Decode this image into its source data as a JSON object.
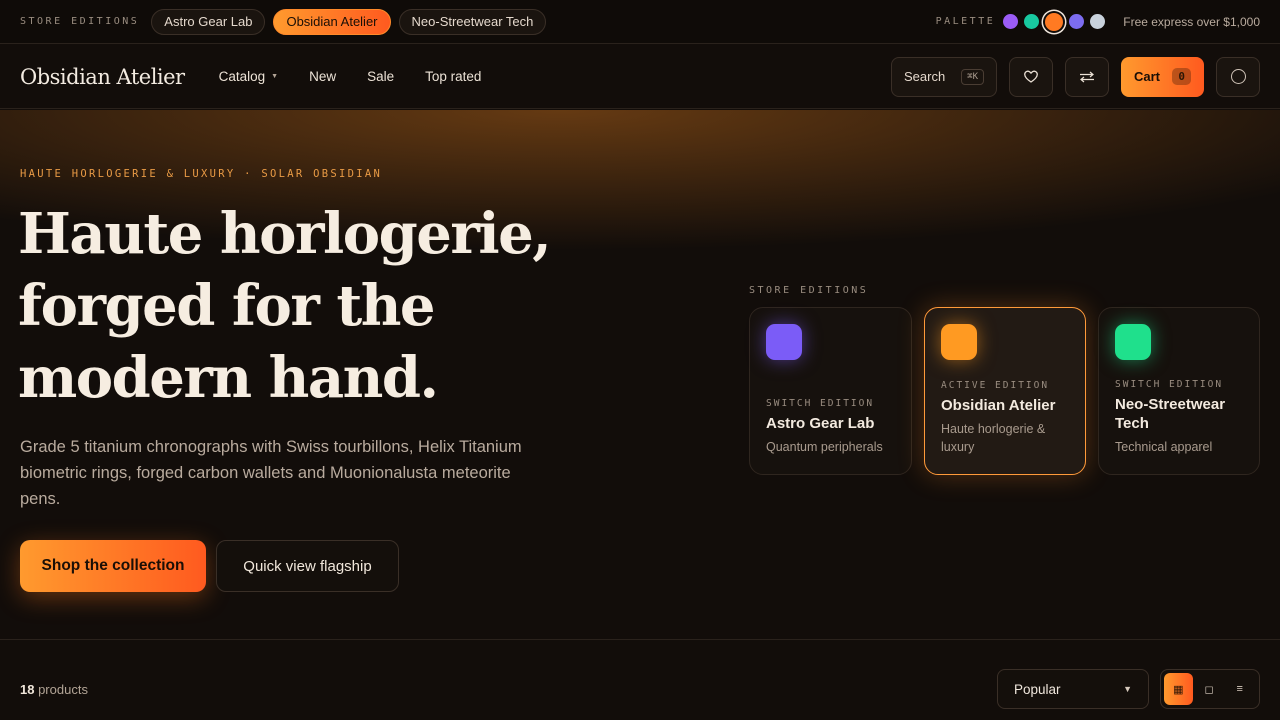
{
  "topbar": {
    "editions_label": "STORE EDITIONS",
    "editions": [
      {
        "label": "Astro Gear Lab",
        "active": false
      },
      {
        "label": "Obsidian Atelier",
        "active": true
      },
      {
        "label": "Neo-Streetwear Tech",
        "active": false
      }
    ],
    "palette_label": "PALETTE",
    "palette": [
      "#9b5cf6",
      "#18c9a0",
      "#ff7a22",
      "#7c6cf0",
      "#c9d2dc"
    ],
    "active_palette_index": 2,
    "promo": "Free express over $1,000"
  },
  "nav": {
    "brand": "Obsidian Atelier",
    "links": [
      {
        "label": "Catalog",
        "has_caret": true
      },
      {
        "label": "New"
      },
      {
        "label": "Sale"
      },
      {
        "label": "Top rated"
      }
    ],
    "search_label": "Search",
    "search_shortcut": "⌘K",
    "wishlist_icon": "heart-icon",
    "compare_icon": "compare-arrows-icon",
    "cart_label": "Cart",
    "cart_count": "0",
    "account_icon": "account-circle-icon"
  },
  "hero": {
    "eyebrow": "HAUTE HORLOGERIE & LUXURY · SOLAR OBSIDIAN",
    "headline": "Haute horlogerie, forged for the modern hand.",
    "lede": "Grade 5 titanium chronographs with Swiss tourbillons, Helix Titanium biometric rings, forged carbon wallets and Muonionalusta meteorite pens.",
    "cta_primary": "Shop the collection",
    "cta_secondary": "Quick view flagship",
    "editions_label": "STORE EDITIONS",
    "edition_cards": [
      {
        "kicker": "SWITCH EDITION",
        "name": "Astro Gear Lab",
        "sub": "Quantum peripherals",
        "color": "#7b5cf7",
        "active": false
      },
      {
        "kicker": "ACTIVE EDITION",
        "name": "Obsidian Atelier",
        "sub": "Haute horlogerie & luxury",
        "color": "#ff9a22",
        "active": true
      },
      {
        "kicker": "SWITCH EDITION",
        "name": "Neo-Streetwear Tech",
        "sub": "Technical apparel",
        "color": "#1fe08c",
        "active": false
      }
    ]
  },
  "listing": {
    "count": "18",
    "count_suffix": " products",
    "sort_value": "Popular",
    "views": [
      {
        "name": "grid-view-icon",
        "glyph": "▦",
        "active": true
      },
      {
        "name": "large-view-icon",
        "glyph": "◻",
        "active": false
      },
      {
        "name": "list-view-icon",
        "glyph": "≡",
        "active": false
      }
    ]
  },
  "colors": {
    "accent_start": "#ff9a2e",
    "accent_end": "#ff5a1f",
    "background": "#120d0a"
  }
}
